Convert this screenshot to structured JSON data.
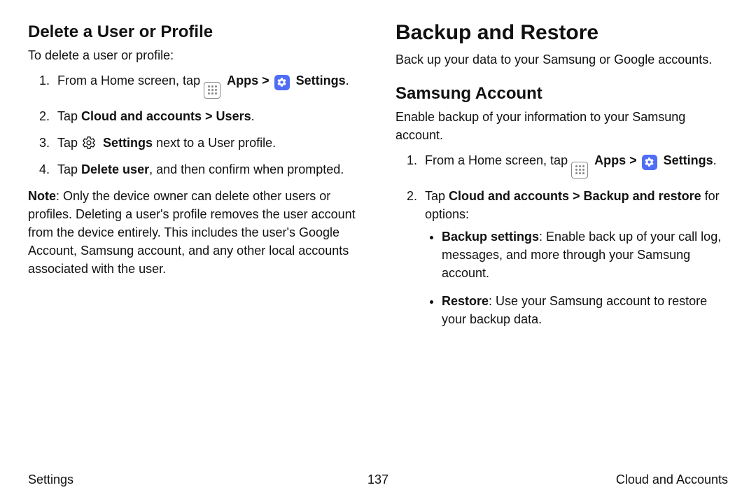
{
  "left": {
    "heading": "Delete a User or Profile",
    "intro": "To delete a user or profile:",
    "steps": {
      "s1_pre": "From a Home screen, tap ",
      "s1_apps": "Apps",
      "s1_chev": " > ",
      "s1_settings": "Settings",
      "s1_end": ".",
      "s2_pre": "Tap ",
      "s2_bold": "Cloud and accounts > Users",
      "s2_end": ".",
      "s3_pre": "Tap ",
      "s3_settings": "Settings",
      "s3_post": " next to a User profile.",
      "s4_pre": "Tap ",
      "s4_bold": "Delete user",
      "s4_post": ", and then confirm when prompted."
    },
    "note_label": "Note",
    "note_body": ": Only the device owner can delete other users or profiles. Deleting a user's profile removes the user account from the device entirely. This includes the user's Google Account, Samsung account, and any other local accounts associated with the user."
  },
  "right": {
    "heading_main": "Backup and Restore",
    "intro_main": "Back up your data to your Samsung or Google accounts.",
    "heading_samsung": "Samsung Account",
    "intro_samsung": "Enable backup of your information to your Samsung account.",
    "steps": {
      "s1_pre": "From a Home screen, tap ",
      "s1_apps": "Apps",
      "s1_chev": " > ",
      "s1_settings": "Settings",
      "s1_end": ".",
      "s2_pre": "Tap ",
      "s2_bold": "Cloud and accounts > Backup and restore",
      "s2_post": " for options:"
    },
    "bullets": {
      "b1_label": "Backup settings",
      "b1_body": ": Enable back up of your call log, messages, and more through your Samsung account.",
      "b2_label": "Restore",
      "b2_body": ": Use your Samsung account to restore your backup data."
    }
  },
  "footer": {
    "left": "Settings",
    "center": "137",
    "right": "Cloud and Accounts"
  }
}
